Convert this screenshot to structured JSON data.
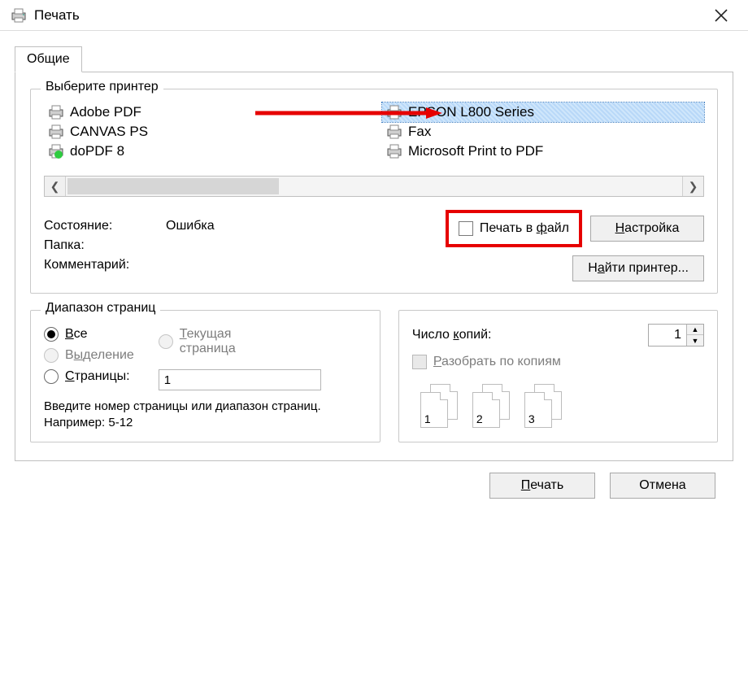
{
  "window": {
    "title": "Печать"
  },
  "tabs": {
    "general": "Общие"
  },
  "select_printer": {
    "legend": "Выберите принтер",
    "left": [
      {
        "name": "Adobe PDF"
      },
      {
        "name": "CANVAS PS"
      },
      {
        "name": "doPDF 8",
        "status_ok": true
      }
    ],
    "right": [
      {
        "name": "EPSON L800 Series",
        "selected": true
      },
      {
        "name": "Fax"
      },
      {
        "name": "Microsoft Print to PDF"
      }
    ]
  },
  "status": {
    "state_label": "Состояние:",
    "state_value": "Ошибка",
    "folder_label": "Папка:",
    "comment_label": "Комментарий:"
  },
  "print_to_file": {
    "label": "Печать в файл",
    "underline": "ф"
  },
  "settings_btn": "Настройка",
  "find_printer_btn": "Найти принтер...",
  "page_range": {
    "legend": "Диапазон страниц",
    "all": "Все",
    "current": "Текущая страница",
    "selection": "Выделение",
    "pages": "Страницы:",
    "pages_value": "1",
    "hint": "Введите номер страницы или диапазон страниц. Например: 5-12"
  },
  "copies": {
    "legend_label": "Число копий:",
    "legend_underline": "к",
    "value": "1",
    "collate": "Разобрать по копиям",
    "collate_underline": "Р"
  },
  "footer": {
    "print": "Печать",
    "cancel": "Отмена"
  }
}
